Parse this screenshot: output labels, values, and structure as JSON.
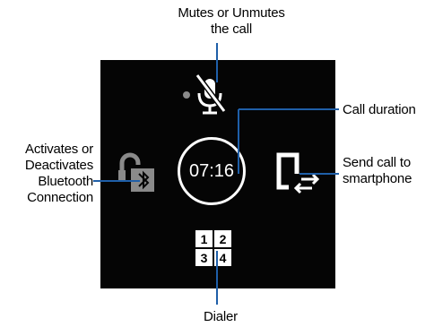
{
  "callouts": {
    "mute": [
      "Mutes or Unmutes",
      "the call"
    ],
    "duration": [
      "Call duration"
    ],
    "bluetooth": [
      "Activates or",
      "Deactivates",
      "Bluetooth",
      "Connection"
    ],
    "send": [
      "Send call to",
      "smartphone"
    ],
    "dialer": [
      "Dialer"
    ]
  },
  "screen": {
    "duration": "07:16",
    "dialer_keys": [
      "1",
      "2",
      "3",
      "4"
    ],
    "icons": [
      "mute-microphone-icon",
      "bluetooth-lock-icon",
      "send-to-phone-icon",
      "dialer-icon"
    ]
  },
  "colors": {
    "screen_bg": "#050505",
    "foreground": "#ffffff",
    "muted_icon": "#8a8a8a",
    "callout_line": "#1f5fa8"
  }
}
